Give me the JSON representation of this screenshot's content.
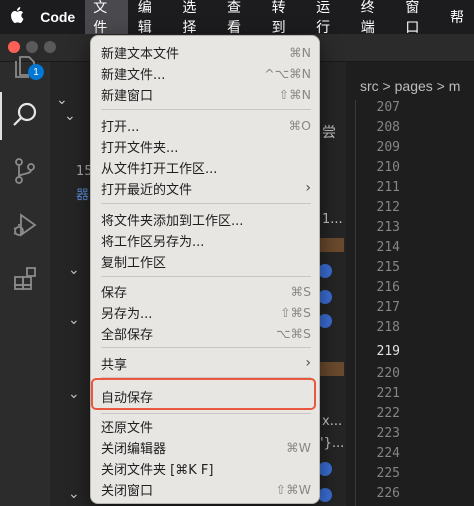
{
  "menubar": {
    "app_name": "Code",
    "items": [
      "文件",
      "编辑",
      "选择",
      "查看",
      "转到",
      "运行",
      "终端",
      "窗口",
      "帮"
    ]
  },
  "activity_bar": {
    "badge_count": "1",
    "icons": [
      "files-icon",
      "search-icon",
      "source-control-icon",
      "run-debug-icon",
      "extensions-icon"
    ]
  },
  "sidebar_fragments": {
    "f1": "尝",
    "f2": "15",
    "f3": "器",
    "f4": "1...",
    "f5": "x...",
    "f6": "'}..."
  },
  "editor": {
    "breadcrumb": "src > pages > m",
    "line_numbers": [
      "207",
      "208",
      "209",
      "210",
      "211",
      "212",
      "213",
      "214",
      "215",
      "216",
      "217",
      "218",
      "219",
      "220",
      "221",
      "222",
      "223",
      "224",
      "225",
      "226"
    ],
    "current_line": "219"
  },
  "file_menu": {
    "items": [
      {
        "label": "新建文本文件",
        "shortcut": "⌘N"
      },
      {
        "label": "新建文件...",
        "shortcut": "^⌥⌘N"
      },
      {
        "label": "新建窗口",
        "shortcut": "⇧⌘N"
      },
      {
        "label": "打开...",
        "shortcut": "⌘O"
      },
      {
        "label": "打开文件夹...",
        "shortcut": ""
      },
      {
        "label": "从文件打开工作区...",
        "shortcut": ""
      },
      {
        "label": "打开最近的文件",
        "shortcut": "",
        "submenu": "›"
      },
      {
        "label": "将文件夹添加到工作区...",
        "shortcut": ""
      },
      {
        "label": "将工作区另存为...",
        "shortcut": ""
      },
      {
        "label": "复制工作区",
        "shortcut": ""
      },
      {
        "label": "保存",
        "shortcut": "⌘S"
      },
      {
        "label": "另存为...",
        "shortcut": "⇧⌘S"
      },
      {
        "label": "全部保存",
        "shortcut": "⌥⌘S"
      },
      {
        "label": "共享",
        "shortcut": "",
        "submenu": "›"
      },
      {
        "label": "自动保存",
        "shortcut": ""
      },
      {
        "label": "还原文件",
        "shortcut": ""
      },
      {
        "label": "关闭编辑器",
        "shortcut": "⌘W"
      },
      {
        "label": "关闭文件夹 [⌘K F]",
        "shortcut": ""
      },
      {
        "label": "关闭窗口",
        "shortcut": "⇧⌘W"
      }
    ]
  },
  "colors": {
    "highlight_border": "#e8573e",
    "badge": "#0078d4"
  }
}
